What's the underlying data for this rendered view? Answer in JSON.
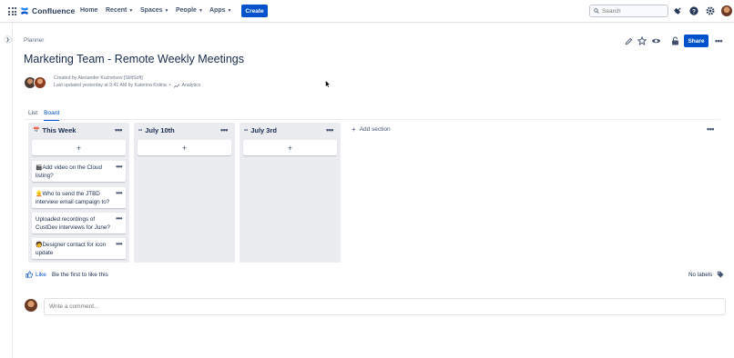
{
  "topnav": {
    "brand": "Confluence",
    "items": [
      {
        "label": "Home",
        "has_dropdown": false
      },
      {
        "label": "Recent",
        "has_dropdown": true
      },
      {
        "label": "Spaces",
        "has_dropdown": true
      },
      {
        "label": "People",
        "has_dropdown": true
      },
      {
        "label": "Apps",
        "has_dropdown": true
      }
    ],
    "create_label": "Create",
    "search_placeholder": "Search",
    "icons": [
      "notifications-icon",
      "help-icon",
      "settings-icon"
    ],
    "brand_color": "#0052cc"
  },
  "page": {
    "breadcrumb": "Planner",
    "title": "Marketing Team - Remote Weekly Meetings",
    "created_by": "Created by Alexander Kuznetsov [StiltSoft]",
    "last_updated": "Last updated yesterday at 9:41 AM by Katerina Kolina",
    "analytics_label": "Analytics",
    "share_label": "Share"
  },
  "tabs": [
    {
      "label": "List",
      "active": false
    },
    {
      "label": "Board",
      "active": true
    }
  ],
  "board": {
    "columns": [
      {
        "title": "This Week",
        "cards": [
          {
            "text": "Add video on the Cloud listing?"
          },
          {
            "text": "Who to send the JTBD interview email campaign to?"
          },
          {
            "text": "Uploaded recordings of CustDev interviews for June?"
          },
          {
            "text": "Designer contact for icon update"
          }
        ]
      },
      {
        "title": "July 10th",
        "cards": []
      },
      {
        "title": "July 3rd",
        "cards": []
      }
    ],
    "add_card_symbol": "+",
    "add_section_label": "Add section"
  },
  "footer": {
    "like_label": "Like",
    "first_like_text": "Be the first to like this",
    "labels_text": "No labels",
    "comment_placeholder": "Write a comment..."
  }
}
